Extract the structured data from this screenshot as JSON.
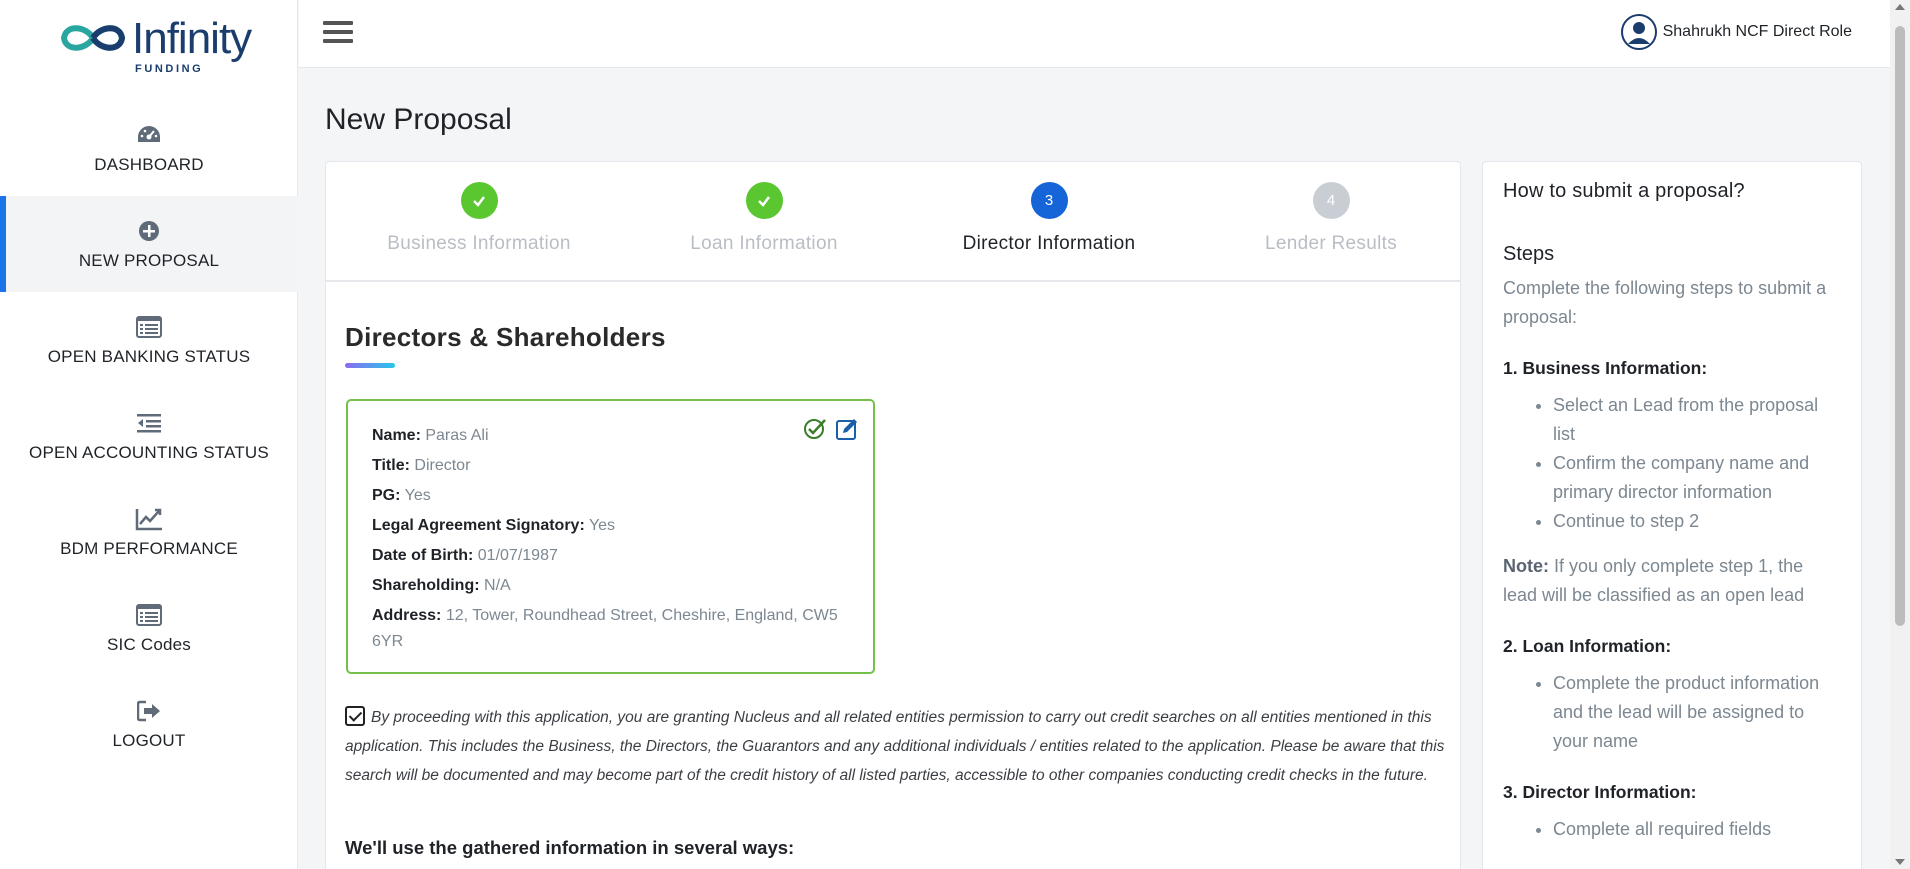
{
  "brand": {
    "name": "Infinity",
    "sub": "FUNDING",
    "colors": {
      "navy": "#1a3d6e",
      "teal": "#2aa6a0",
      "accent": "#1a73e8",
      "done": "#5ac731",
      "current": "#1565d8"
    }
  },
  "sidebar": {
    "items": [
      {
        "label": "DASHBOARD",
        "icon": "dashboard-gauge-icon",
        "active": false
      },
      {
        "label": "NEW PROPOSAL",
        "icon": "plus-circle-icon",
        "active": true
      },
      {
        "label": "OPEN BANKING STATUS",
        "icon": "list-window-icon",
        "active": false
      },
      {
        "label": "OPEN ACCOUNTING STATUS",
        "icon": "indent-list-icon",
        "active": false
      },
      {
        "label": "BDM PERFORMANCE",
        "icon": "line-chart-icon",
        "active": false
      },
      {
        "label": "SIC Codes",
        "icon": "list-window-icon",
        "active": false
      },
      {
        "label": "LOGOUT",
        "icon": "logout-icon",
        "active": false
      }
    ]
  },
  "header": {
    "user_name": "Shahrukh NCF Direct Role"
  },
  "page": {
    "title": "New Proposal"
  },
  "steps": [
    {
      "number": "1",
      "label": "Business Information",
      "state": "done"
    },
    {
      "number": "2",
      "label": "Loan Information",
      "state": "done"
    },
    {
      "number": "3",
      "label": "Director Information",
      "state": "current"
    },
    {
      "number": "4",
      "label": "Lender Results",
      "state": "todo"
    }
  ],
  "directors": {
    "section_title": "Directors & Shareholders",
    "card": {
      "name_label": "Name:",
      "name": "Paras Ali",
      "title_label": "Title:",
      "title": "Director",
      "pg_label": "PG:",
      "pg": "Yes",
      "signatory_label": "Legal Agreement Signatory:",
      "signatory": "Yes",
      "dob_label": "Date of Birth:",
      "dob": "01/07/1987",
      "shareholding_label": "Shareholding:",
      "shareholding": "N/A",
      "address_label": "Address:",
      "address": "12, Tower, Roundhead Street, Cheshire, England, CW5 6YR"
    }
  },
  "consent": {
    "checked": true,
    "text": "By proceeding with this application, you are granting Nucleus and all related entities permission to carry out credit searches on all entities mentioned in this application. This includes the Business, the Directors, the Guarantors and any additional individuals / entities related to the application. Please be aware that this search will be documented and may become part of the credit history of all listed parties, accessible to other companies conducting credit checks in the future."
  },
  "ways_heading": "We'll use the gathered information in several ways:",
  "help": {
    "title": "How to submit a proposal?",
    "steps_heading": "Steps",
    "intro": "Complete the following steps to submit a proposal:",
    "step1_title": "1. Business Information:",
    "step1_items": [
      "Select an Lead from the proposal list",
      "Confirm the company name and primary director information",
      "Continue to step 2"
    ],
    "note_label": "Note:",
    "note_text": " If you only complete step 1, the lead will be classified as an open lead",
    "step2_title": "2. Loan Information:",
    "step2_items": [
      "Complete the product information and the lead will be assigned to your name"
    ],
    "step3_title": "3. Director Information:",
    "step3_items": [
      "Complete all required fields"
    ]
  }
}
